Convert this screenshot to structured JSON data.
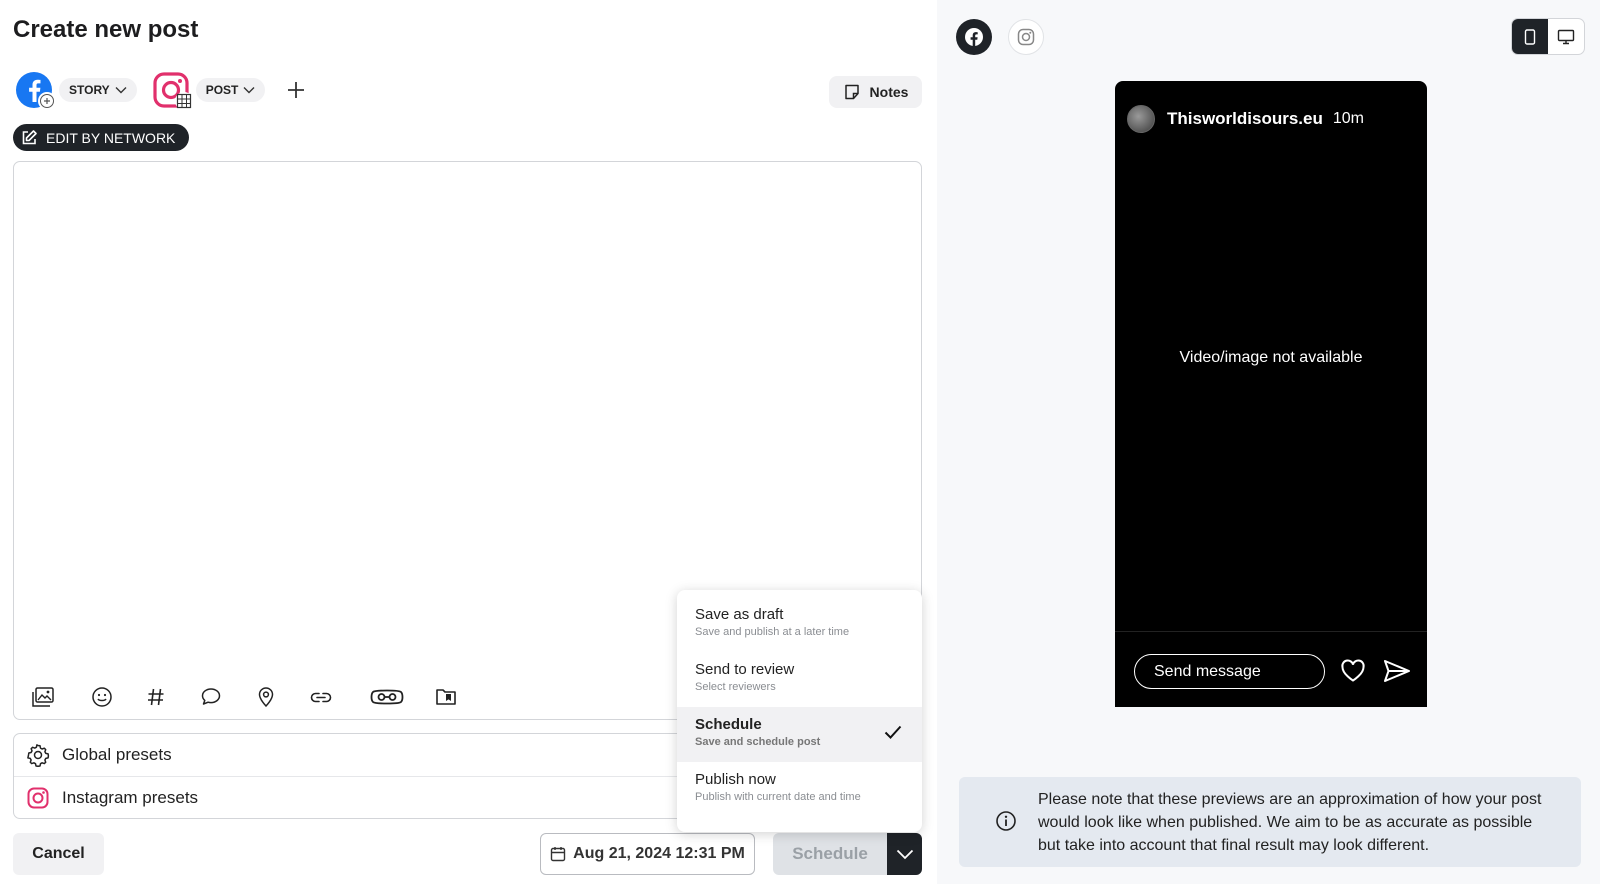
{
  "page": {
    "title": "Create new post"
  },
  "networks": [
    {
      "name": "facebook",
      "type_label": "STORY"
    },
    {
      "name": "instagram",
      "type_label": "POST"
    }
  ],
  "notes_label": "Notes",
  "edit_by_network_label": "EDIT BY NETWORK",
  "editor": {
    "toolbar_icons": [
      "media-icon",
      "emoji-icon",
      "hashtag-icon",
      "comment-icon",
      "location-icon",
      "link-icon",
      "ai-icon",
      "library-icon"
    ]
  },
  "presets": [
    {
      "label": "Global presets",
      "icon": "gear-icon"
    },
    {
      "label": "Instagram presets",
      "icon": "instagram-icon"
    }
  ],
  "footer": {
    "cancel_label": "Cancel",
    "date_label": "Aug 21, 2024 12:31 PM",
    "schedule_label": "Schedule"
  },
  "publish_menu": {
    "items": [
      {
        "label": "Save as draft",
        "sub": "Save and publish at a later time",
        "selected": false
      },
      {
        "label": "Send to review",
        "sub": "Select reviewers",
        "selected": false
      },
      {
        "label": "Schedule",
        "sub": "Save and schedule post",
        "selected": true
      },
      {
        "label": "Publish now",
        "sub": "Publish with current date and time",
        "selected": false
      }
    ]
  },
  "preview": {
    "username": "Thisworldisours.eu",
    "time": "10m",
    "unavailable_text": "Video/image not available",
    "send_placeholder": "Send message",
    "notice": "Please note that these previews are an approximation of how your post would look like when published. We aim to be as accurate as possible but take into account that final result may look different."
  },
  "colors": {
    "facebook": "#1877f2",
    "instagram": "#e1306c",
    "dark": "#1f2328"
  }
}
